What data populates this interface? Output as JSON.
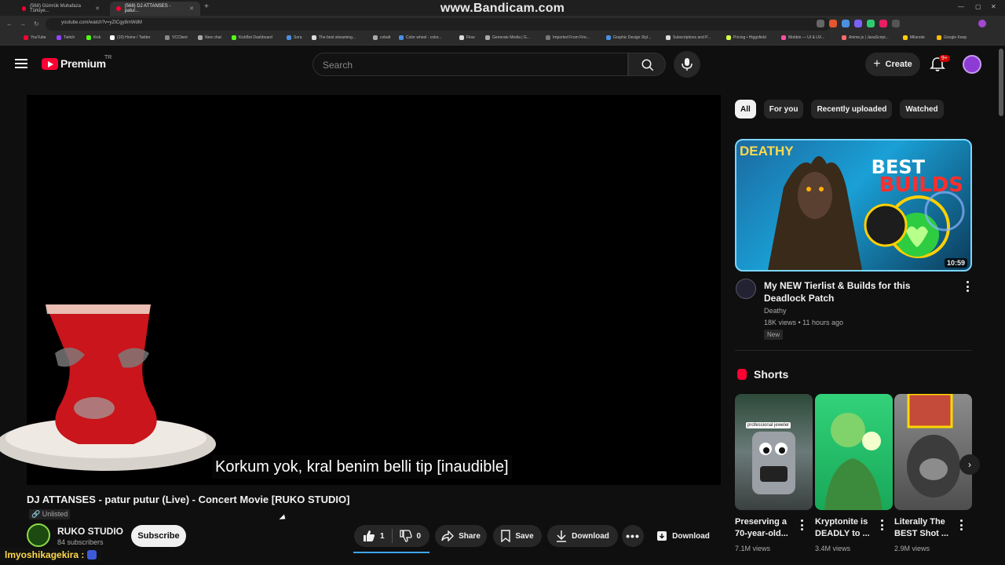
{
  "recording_watermark": "www.Bandicam.com",
  "browser": {
    "tabs": [
      {
        "label": "(568) Gümrük Muhafaza Türkiye..."
      },
      {
        "label": "(568) DJ ATTANSES - patur..."
      }
    ],
    "url": "youtube.com/watch?v=yZtCgy8mWdM",
    "bookmarks": [
      "YouTube",
      "Twitch",
      "Kick",
      "(10) Home / Twitter",
      "VCClient",
      "New chat",
      "KickBot Dashboard",
      "Sora",
      "The best streaming...",
      "cobalt",
      "Color wheel - color...",
      "Flow",
      "Generate Media | G...",
      "Imported From Fire...",
      "Graphic Design Styl...",
      "Subscriptions and P...",
      "Pricing • Higgsfield",
      "Mobbin — UI & UX...",
      "Anime.js | JavaScript...",
      "Milanote",
      "Google Keep"
    ]
  },
  "header": {
    "logo_text": "Premium",
    "country_code": "TR",
    "search_placeholder": "Search",
    "create_label": "Create",
    "notification_count": "9+"
  },
  "player": {
    "subtitle": "Korkum yok, kral benim belli tip [inaudible]"
  },
  "video": {
    "title": "DJ ATTANSES - patur putur (Live) - Concert Movie [RUKO STUDIO]",
    "visibility": "Unlisted",
    "channel_name": "RUKO STUDIO",
    "subscribers": "84 subscribers",
    "subscribe_label": "Subscribe",
    "likes": "1",
    "dislikes": "0",
    "share_label": "Share",
    "save_label": "Save",
    "download_label": "Download",
    "download2_label": "Download"
  },
  "streamer_overlay": "lmyoshikagekira :",
  "sidebar": {
    "chips": [
      {
        "label": "All",
        "active": true
      },
      {
        "label": "For you",
        "active": false
      },
      {
        "label": "Recently uploaded",
        "active": false
      },
      {
        "label": "Watched",
        "active": false
      }
    ],
    "recommended": {
      "thumb_brand": "DEATHY",
      "thumb_text_1": "BEST",
      "thumb_text_2": "BUILDS",
      "duration": "10:59",
      "title": "My NEW Tierlist & Builds for this Deadlock Patch",
      "channel": "Deathy",
      "meta": "18K views • 11 hours ago",
      "badge": "New"
    },
    "shorts_heading": "Shorts",
    "shorts": [
      {
        "title": "Preserving a 70-year-old...",
        "views": "7.1M views",
        "overlay": "professional jeweler"
      },
      {
        "title": "Kryptonite is DEADLY to ...",
        "views": "3.4M views"
      },
      {
        "title": "Literally The BEST Shot ...",
        "views": "2.9M views"
      }
    ]
  }
}
